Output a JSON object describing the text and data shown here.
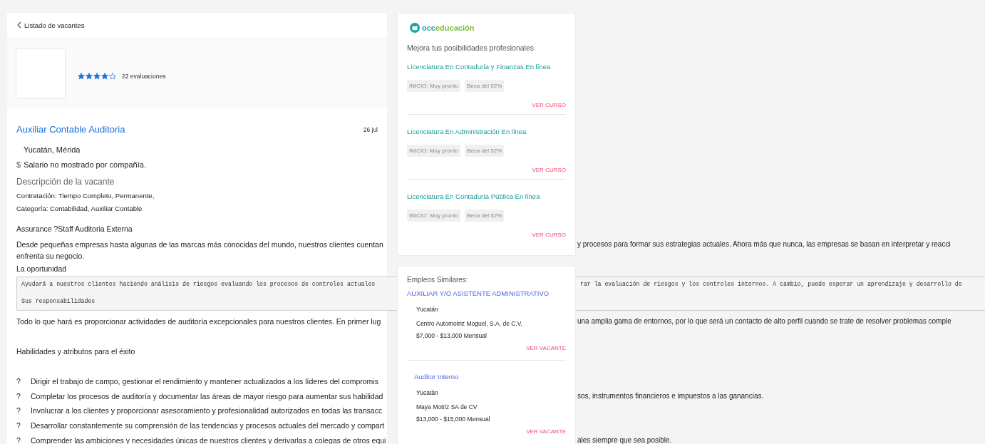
{
  "back_link": "Listado de vacantes",
  "company": {
    "stars": 4,
    "reviews": "22 evaluaciones"
  },
  "job": {
    "title": "Auxiliar Contable Auditoria",
    "date": "26 jul",
    "location": "Yucatán, Mérida",
    "salary_symbol": "$",
    "salary": "Salario no mostrado por compañía."
  },
  "description": {
    "heading": "Descripción de la vacante",
    "details": [
      "Contratación: Tiempo Completo, Permanente,",
      "Categoría: Contabilidad, Auxiliar Contable"
    ],
    "subtitle": "Assurance ?Staff Auditoria Externa",
    "intro": [
      {
        "left": "Desde pequeñas empresas hasta algunas de las marcas más conocidas del mundo, nuestros clientes cuentan",
        "right": "y procesos para formar sus estrategias actuales. Ahora más que nunca, las empresas se basan en interpretar y reacci"
      },
      {
        "left": "enfrenta su negocio."
      }
    ],
    "opportunity_heading": "La oportunidad",
    "code_lines": [
      {
        "left": "Ayudará a nuestros clientes haciendo análisis de riesgos evaluando los procesos de controles actuales",
        "right": "rar la evaluación de riesgos y los controles internos. A cambio, puede esperar un aprendizaje y desarrollo de"
      },
      {
        "left": "Sus responsabilidades"
      }
    ],
    "summary": {
      "left": "Todo lo que hará es proporcionar actividades de auditoría excepcionales para nuestros clientes. En primer lug",
      "right": "una amplia gama de entornos, por lo que será un contacto de alto perfil cuando se trate de resolver problemas comple"
    },
    "skills_heading": "Habilidades y atributos para el éxito",
    "skills": [
      {
        "marker": "?",
        "left": "Dirigir el trabajo de campo, gestionar el rendimiento y mantener actualizados a los líderes del compromis"
      },
      {
        "marker": "?",
        "left": "Completar los procesos de auditoría y documentar las áreas de mayor riesgo para aumentar sus habilidad",
        "right": "sos, instrumentos financieros e impuestos a las ganancias."
      },
      {
        "marker": "?",
        "left": "Involucrar a los clientes y proporcionar asesoramiento y profesionalidad autorizados en todas las transacc"
      },
      {
        "marker": "?",
        "left": "Desarrollar constantemente su comprensión de las tendencias y procesos actuales del mercado y compart"
      },
      {
        "marker": "?",
        "left": "Comprender las ambiciones y necesidades únicas de nuestros clientes y derivarlas a colegas de otros equi",
        "right": "ales siempre que sea posible."
      }
    ]
  },
  "education": {
    "logo_prefix": "occ",
    "logo_suffix": "educación",
    "heading": "Mejora tus posibilidades profesionales",
    "courses": [
      {
        "title": "Licenciatura En Contaduría y Finanzas En línea",
        "tags": [
          "INICIO: Muy pronto",
          "Beca del 52%"
        ],
        "action": "VER CURSO"
      },
      {
        "title": "Licenciatura En Administración En línea",
        "tags": [
          "INICIO: Muy pronto",
          "Beca del 52%"
        ],
        "action": "VER CURSO"
      },
      {
        "title": "Licenciatura En Contaduría Pública En línea",
        "tags": [
          "INICIO: Muy pronto",
          "Beca del 52%"
        ],
        "action": "VER CURSO"
      }
    ]
  },
  "similar_jobs": {
    "heading": "Empleos Similares:",
    "jobs": [
      {
        "title": "AUXILIAR Y/O ASISTENTE ADMINISTRATIVO",
        "location": "Yucatán",
        "company": "Centro Automotriz Moguel, S.A. de C.V.",
        "salary": "$7,000 - $13,000 Mensual",
        "action": "VER VACANTE"
      },
      {
        "title": "Auditor Interno",
        "location": "Yucatán",
        "company": "Maya Motriz SA de CV",
        "salary": "$13,000 - $15,000 Mensual",
        "action": "VER VACANTE"
      }
    ]
  }
}
